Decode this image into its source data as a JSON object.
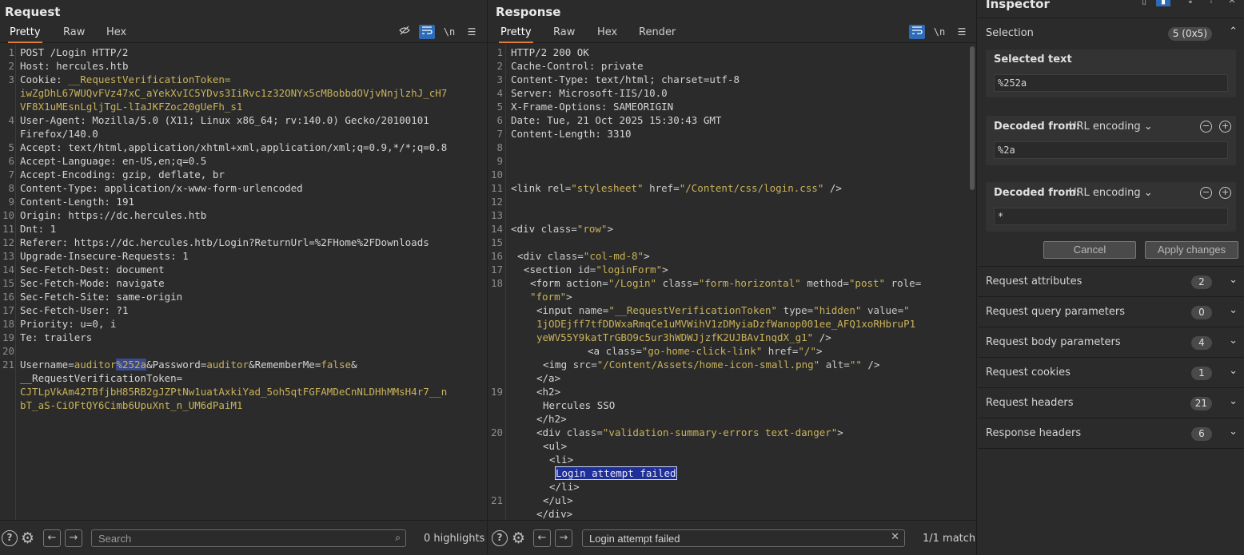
{
  "request": {
    "title": "Request",
    "tabs": [
      "Pretty",
      "Raw",
      "Hex"
    ],
    "active_tab": "Pretty",
    "lines": [
      {
        "n": "1",
        "parts": [
          [
            "hk",
            "POST /Login HTTP/2"
          ]
        ]
      },
      {
        "n": "2",
        "parts": [
          [
            "hk",
            "Host: "
          ],
          [
            "hv",
            "hercules.htb"
          ]
        ]
      },
      {
        "n": "3",
        "parts": [
          [
            "hk",
            "Cookie: "
          ],
          [
            "tok",
            "__RequestVerificationToken="
          ]
        ]
      },
      {
        "n": "",
        "parts": [
          [
            "tok",
            "iwZgDhL67WUQvFVz47xC_aYekXvIC5YDvs3IiRvc1z32ONYx5cMBobbdOVjvNnjlzhJ_cH7"
          ]
        ]
      },
      {
        "n": "",
        "parts": [
          [
            "tok",
            "VF8X1uMEsnLgljTgL-lIaJKFZoc20gUeFh_s1"
          ]
        ]
      },
      {
        "n": "4",
        "parts": [
          [
            "hk",
            "User-Agent: "
          ],
          [
            "hv",
            "Mozilla/5.0 (X11; Linux x86_64; rv:140.0) Gecko/20100101"
          ]
        ]
      },
      {
        "n": "",
        "parts": [
          [
            "hv",
            "Firefox/140.0"
          ]
        ]
      },
      {
        "n": "5",
        "parts": [
          [
            "hk",
            "Accept: "
          ],
          [
            "hv",
            "text/html,application/xhtml+xml,application/xml;q=0.9,*/*;q=0.8"
          ]
        ]
      },
      {
        "n": "6",
        "parts": [
          [
            "hk",
            "Accept-Language: "
          ],
          [
            "hv",
            "en-US,en;q=0.5"
          ]
        ]
      },
      {
        "n": "7",
        "parts": [
          [
            "hk",
            "Accept-Encoding: "
          ],
          [
            "hv",
            "gzip, deflate, br"
          ]
        ]
      },
      {
        "n": "8",
        "parts": [
          [
            "hk",
            "Content-Type: "
          ],
          [
            "hv",
            "application/x-www-form-urlencoded"
          ]
        ]
      },
      {
        "n": "9",
        "parts": [
          [
            "hk",
            "Content-Length: "
          ],
          [
            "hv",
            "191"
          ]
        ]
      },
      {
        "n": "10",
        "parts": [
          [
            "hk",
            "Origin: "
          ],
          [
            "hv",
            "https://dc.hercules.htb"
          ]
        ]
      },
      {
        "n": "11",
        "parts": [
          [
            "hk",
            "Dnt: "
          ],
          [
            "hv",
            "1"
          ]
        ]
      },
      {
        "n": "12",
        "parts": [
          [
            "hk",
            "Referer: "
          ],
          [
            "hv",
            "https://dc.hercules.htb/Login?ReturnUrl=%2FHome%2FDownloads"
          ]
        ]
      },
      {
        "n": "13",
        "parts": [
          [
            "hk",
            "Upgrade-Insecure-Requests: "
          ],
          [
            "hv",
            "1"
          ]
        ]
      },
      {
        "n": "14",
        "parts": [
          [
            "hk",
            "Sec-Fetch-Dest: "
          ],
          [
            "hv",
            "document"
          ]
        ]
      },
      {
        "n": "15",
        "parts": [
          [
            "hk",
            "Sec-Fetch-Mode: "
          ],
          [
            "hv",
            "navigate"
          ]
        ]
      },
      {
        "n": "16",
        "parts": [
          [
            "hk",
            "Sec-Fetch-Site: "
          ],
          [
            "hv",
            "same-origin"
          ]
        ]
      },
      {
        "n": "17",
        "parts": [
          [
            "hk",
            "Sec-Fetch-User: "
          ],
          [
            "hv",
            "?1"
          ]
        ]
      },
      {
        "n": "18",
        "parts": [
          [
            "hk",
            "Priority: "
          ],
          [
            "hv",
            "u=0, i"
          ]
        ]
      },
      {
        "n": "19",
        "parts": [
          [
            "hk",
            "Te: "
          ],
          [
            "hv",
            "trailers"
          ]
        ]
      },
      {
        "n": "20",
        "parts": []
      },
      {
        "n": "21",
        "parts": [
          [
            "hk",
            "Username"
          ],
          [
            "hv",
            "="
          ],
          [
            "tok",
            "auditor"
          ],
          [
            "sel-hl",
            "%252a"
          ],
          [
            "hv",
            "&"
          ],
          [
            "hk",
            "Password"
          ],
          [
            "hv",
            "="
          ],
          [
            "tok",
            "auditor"
          ],
          [
            "hv",
            "&"
          ],
          [
            "hk",
            "RememberMe"
          ],
          [
            "hv",
            "="
          ],
          [
            "tok",
            "false"
          ],
          [
            "hv",
            "&"
          ]
        ]
      },
      {
        "n": "",
        "parts": [
          [
            "hk",
            "__RequestVerificationToken"
          ],
          [
            "hv",
            "="
          ]
        ]
      },
      {
        "n": "",
        "parts": [
          [
            "tok",
            "CJTLpVkAm42TBfjbH85RB2gJZPtNw1uatAxkiYad_5oh5qtFGFAMDeCnNLDHhMMsH4r7__n"
          ]
        ]
      },
      {
        "n": "",
        "parts": [
          [
            "tok",
            "bT_aS-CiOFtQY6Cimb6UpuXnt_n_UM6dPaiM1"
          ]
        ]
      }
    ],
    "footer": {
      "search_placeholder": "Search",
      "status": "0 highlights"
    }
  },
  "response": {
    "title": "Response",
    "tabs": [
      "Pretty",
      "Raw",
      "Hex",
      "Render"
    ],
    "active_tab": "Pretty",
    "lines": [
      {
        "n": "1",
        "indent": 0,
        "parts": [
          [
            "hk",
            "HTTP/2 200 OK"
          ]
        ]
      },
      {
        "n": "2",
        "indent": 0,
        "parts": [
          [
            "hk",
            "Cache-Control: "
          ],
          [
            "hv",
            "private"
          ]
        ]
      },
      {
        "n": "3",
        "indent": 0,
        "parts": [
          [
            "hk",
            "Content-Type: "
          ],
          [
            "hv",
            "text/html; charset=utf-8"
          ]
        ]
      },
      {
        "n": "4",
        "indent": 0,
        "parts": [
          [
            "hk",
            "Server: "
          ],
          [
            "hv",
            "Microsoft-IIS/10.0"
          ]
        ]
      },
      {
        "n": "5",
        "indent": 0,
        "parts": [
          [
            "hk",
            "X-Frame-Options: "
          ],
          [
            "hv",
            "SAMEORIGIN"
          ]
        ]
      },
      {
        "n": "6",
        "indent": 0,
        "parts": [
          [
            "hk",
            "Date: "
          ],
          [
            "hv",
            "Tue, 21 Oct 2025 15:30:43 GMT"
          ]
        ]
      },
      {
        "n": "7",
        "indent": 0,
        "parts": [
          [
            "hk",
            "Content-Length: "
          ],
          [
            "hv",
            "3310"
          ]
        ]
      },
      {
        "n": "8",
        "indent": 0,
        "parts": []
      },
      {
        "n": "9",
        "indent": 0,
        "parts": []
      },
      {
        "n": "10",
        "indent": 0,
        "parts": []
      },
      {
        "n": "11",
        "indent": 0,
        "parts": [
          [
            "tag",
            "<link "
          ],
          [
            "attr",
            "rel="
          ],
          [
            "str",
            "\"stylesheet\""
          ],
          [
            "attr",
            " href="
          ],
          [
            "str",
            "\"/Content/css/login.css\""
          ],
          [
            "tag",
            " />"
          ]
        ]
      },
      {
        "n": "12",
        "indent": 0,
        "parts": []
      },
      {
        "n": "13",
        "indent": 0,
        "parts": []
      },
      {
        "n": "14",
        "indent": 0,
        "parts": [
          [
            "tag",
            "<div "
          ],
          [
            "attr",
            "class="
          ],
          [
            "str",
            "\"row\""
          ],
          [
            "tag",
            ">"
          ]
        ]
      },
      {
        "n": "15",
        "indent": 0,
        "parts": []
      },
      {
        "n": "16",
        "indent": 1,
        "parts": [
          [
            "tag",
            "<div "
          ],
          [
            "attr",
            "class="
          ],
          [
            "str",
            "\"col-md-8\""
          ],
          [
            "tag",
            ">"
          ]
        ]
      },
      {
        "n": "17",
        "indent": 2,
        "parts": [
          [
            "tag",
            "<section "
          ],
          [
            "attr",
            "id="
          ],
          [
            "str",
            "\"loginForm\""
          ],
          [
            "tag",
            ">"
          ]
        ]
      },
      {
        "n": "18",
        "indent": 3,
        "parts": [
          [
            "tag",
            "<form "
          ],
          [
            "attr",
            "action="
          ],
          [
            "str",
            "\"/Login\""
          ],
          [
            "attr",
            " class="
          ],
          [
            "str",
            "\"form-horizontal\""
          ],
          [
            "attr",
            " method="
          ],
          [
            "str",
            "\"post\""
          ],
          [
            "attr",
            " role="
          ]
        ]
      },
      {
        "n": "",
        "indent": 3,
        "parts": [
          [
            "str",
            "\"form\""
          ],
          [
            "tag",
            ">"
          ]
        ]
      },
      {
        "n": "",
        "indent": 4,
        "parts": [
          [
            "tag",
            "<input "
          ],
          [
            "attr",
            "name="
          ],
          [
            "str",
            "\"__RequestVerificationToken\""
          ],
          [
            "attr",
            " type="
          ],
          [
            "str",
            "\"hidden\""
          ],
          [
            "attr",
            " value="
          ],
          [
            "str",
            "\""
          ]
        ]
      },
      {
        "n": "",
        "indent": 4,
        "parts": [
          [
            "str",
            "1jODEjff7tfDDWxaRmqCe1uMVWihV1zDMyiaDzfWanop001ee_AFQ1xoRHbruP1"
          ]
        ]
      },
      {
        "n": "",
        "indent": 4,
        "parts": [
          [
            "str",
            "yeWV55Y9katTrGBO9c5ur3hWDWJjzfK2UJBAvInqdX_g1\""
          ],
          [
            "tag",
            " />"
          ]
        ]
      },
      {
        "n": "",
        "indent": 12,
        "parts": [
          [
            "tag",
            "<a "
          ],
          [
            "attr",
            "class="
          ],
          [
            "str",
            "\"go-home-click-link\""
          ],
          [
            "attr",
            " href="
          ],
          [
            "str",
            "\"/\""
          ],
          [
            "tag",
            ">"
          ]
        ]
      },
      {
        "n": "",
        "indent": 5,
        "parts": [
          [
            "tag",
            "<img "
          ],
          [
            "attr",
            "src="
          ],
          [
            "str",
            "\"/Content/Assets/home-icon-small.png\""
          ],
          [
            "attr",
            " alt="
          ],
          [
            "str",
            "\"\""
          ],
          [
            "tag",
            " />"
          ]
        ]
      },
      {
        "n": "",
        "indent": 4,
        "parts": [
          [
            "tag",
            "</a>"
          ]
        ]
      },
      {
        "n": "19",
        "indent": 4,
        "parts": [
          [
            "tag",
            "<h2>"
          ]
        ]
      },
      {
        "n": "",
        "indent": 5,
        "parts": [
          [
            "hv",
            "Hercules SSO"
          ]
        ]
      },
      {
        "n": "",
        "indent": 4,
        "parts": [
          [
            "tag",
            "</h2>"
          ]
        ]
      },
      {
        "n": "20",
        "indent": 4,
        "parts": [
          [
            "tag",
            "<div "
          ],
          [
            "attr",
            "class="
          ],
          [
            "str",
            "\"validation-summary-errors text-danger\""
          ],
          [
            "tag",
            ">"
          ]
        ]
      },
      {
        "n": "",
        "indent": 5,
        "parts": [
          [
            "tag",
            "<ul>"
          ]
        ]
      },
      {
        "n": "",
        "indent": 6,
        "parts": [
          [
            "tag",
            "<li>"
          ]
        ]
      },
      {
        "n": "",
        "indent": 7,
        "parts": [
          [
            "match-hl",
            "Login attempt failed"
          ]
        ]
      },
      {
        "n": "",
        "indent": 6,
        "parts": [
          [
            "tag",
            "</li>"
          ]
        ]
      },
      {
        "n": "21",
        "indent": 5,
        "parts": [
          [
            "tag",
            "</ul>"
          ]
        ]
      },
      {
        "n": "",
        "indent": 4,
        "parts": [
          [
            "tag",
            "</div>"
          ]
        ]
      }
    ],
    "footer": {
      "search_value": "Login attempt failed",
      "status": "1/1 match"
    }
  },
  "inspector": {
    "title": "Inspector",
    "selection": {
      "label": "Selection",
      "count": "5 (0x5)"
    },
    "selected_text_label": "Selected text",
    "selected_text": "%252a",
    "decoded": [
      {
        "label": "Decoded from:",
        "encoding": "URL encoding",
        "value": "%2a"
      },
      {
        "label": "Decoded from:",
        "encoding": "URL encoding",
        "value": "*"
      }
    ],
    "cancel_label": "Cancel",
    "apply_label": "Apply changes",
    "sections": [
      {
        "label": "Request attributes",
        "count": "2"
      },
      {
        "label": "Request query parameters",
        "count": "0"
      },
      {
        "label": "Request body parameters",
        "count": "4"
      },
      {
        "label": "Request cookies",
        "count": "1"
      },
      {
        "label": "Request headers",
        "count": "21"
      },
      {
        "label": "Response headers",
        "count": "6"
      }
    ]
  },
  "colors": {
    "accent_tab": "#e07b3a",
    "toggle_on": "#2e6ab6",
    "token_value": "#c9b25a",
    "match_highlight": "#1f2f9a"
  },
  "icons": [
    "hide-icon",
    "wrap-icon",
    "newline-icon",
    "menu-icon",
    "help-icon",
    "gear-icon",
    "arrow-left-icon",
    "arrow-right-icon",
    "search-icon",
    "clear-icon",
    "chevron-up-icon",
    "chevron-down-icon",
    "minus-circle-icon",
    "plus-circle-icon"
  ]
}
